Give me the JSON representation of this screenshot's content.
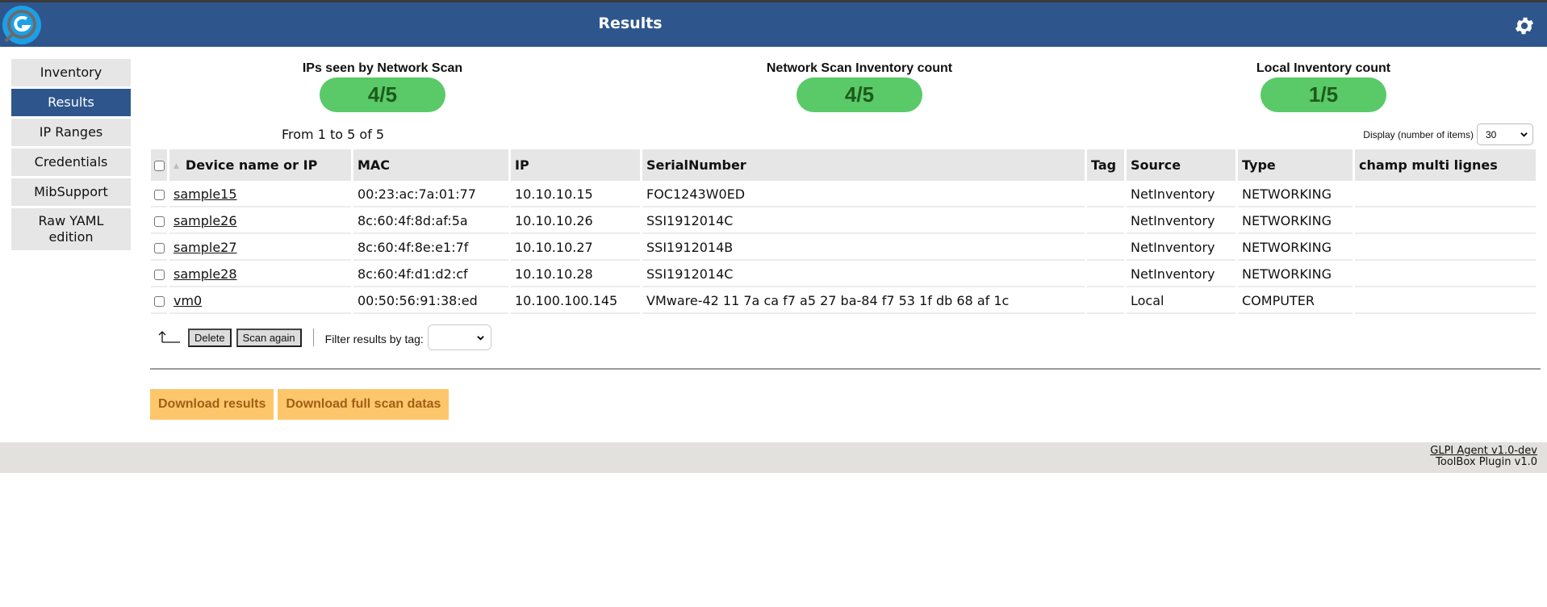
{
  "header": {
    "title": "Results",
    "logo_icon": "glpi-agent-logo-icon",
    "settings_icon": "gear-icon"
  },
  "sidebar": {
    "items": [
      {
        "label": "Inventory",
        "active": false
      },
      {
        "label": "Results",
        "active": true
      },
      {
        "label": "IP Ranges",
        "active": false
      },
      {
        "label": "Credentials",
        "active": false
      },
      {
        "label": "MibSupport",
        "active": false
      },
      {
        "label": "Raw YAML edition",
        "active": false
      }
    ]
  },
  "counters": [
    {
      "label": "IPs seen by Network Scan",
      "value": "4/5"
    },
    {
      "label": "Network Scan Inventory count",
      "value": "4/5"
    },
    {
      "label": "Local Inventory count",
      "value": "1/5"
    }
  ],
  "pagination": {
    "range_text": "From 1 to 5 of 5",
    "display_label": "Display (number of items)",
    "display_value": "30"
  },
  "table": {
    "columns": [
      "Device name or IP",
      "MAC",
      "IP",
      "SerialNumber",
      "Tag",
      "Source",
      "Type",
      "champ multi lignes"
    ],
    "sort_column": "Device name or IP",
    "rows": [
      {
        "name": "sample15",
        "mac": "00:23:ac:7a:01:77",
        "ip": "10.10.10.15",
        "serial": "FOC1243W0ED",
        "tag": "",
        "source": "NetInventory",
        "type": "NETWORKING",
        "multi": ""
      },
      {
        "name": "sample26",
        "mac": "8c:60:4f:8d:af:5a",
        "ip": "10.10.10.26",
        "serial": "SSI1912014C",
        "tag": "",
        "source": "NetInventory",
        "type": "NETWORKING",
        "multi": ""
      },
      {
        "name": "sample27",
        "mac": "8c:60:4f:8e:e1:7f",
        "ip": "10.10.10.27",
        "serial": "SSI1912014B",
        "tag": "",
        "source": "NetInventory",
        "type": "NETWORKING",
        "multi": ""
      },
      {
        "name": "sample28",
        "mac": "8c:60:4f:d1:d2:cf",
        "ip": "10.10.10.28",
        "serial": "SSI1912014C",
        "tag": "",
        "source": "NetInventory",
        "type": "NETWORKING",
        "multi": ""
      },
      {
        "name": "vm0",
        "mac": "00:50:56:91:38:ed",
        "ip": "10.100.100.145",
        "serial": "VMware-42 11 7a ca f7 a5 27 ba-84 f7 53 1f db 68 af 1c",
        "tag": "",
        "source": "Local",
        "type": "COMPUTER",
        "multi": ""
      }
    ]
  },
  "actions": {
    "delete_label": "Delete",
    "scan_again_label": "Scan again",
    "filter_label": "Filter results by tag:",
    "filter_value": ""
  },
  "downloads": {
    "results_label": "Download results",
    "full_scan_label": "Download full scan datas"
  },
  "footer": {
    "agent_link": "GLPI Agent v1.0-dev",
    "plugin_version": "ToolBox Plugin v1.0"
  },
  "colors": {
    "brand_blue": "#2e568c",
    "counter_green": "#5ac968",
    "counter_text": "#1d5a1b",
    "download_orange": "#fec66b",
    "download_text": "#a05f14"
  }
}
